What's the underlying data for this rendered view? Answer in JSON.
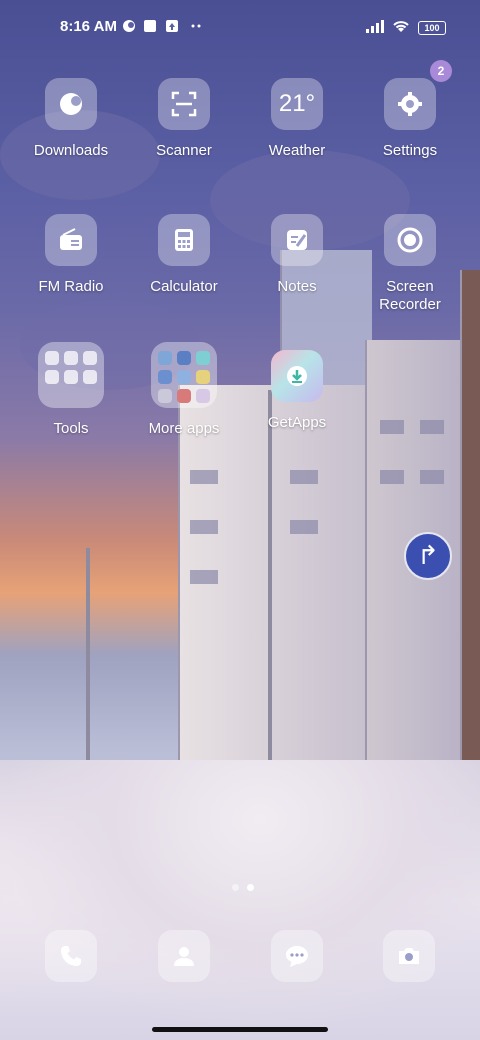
{
  "status_bar": {
    "time": "8:16 AM",
    "battery": "100"
  },
  "apps": [
    {
      "label": "Downloads",
      "icon": "downloads-icon"
    },
    {
      "label": "Scanner",
      "icon": "scanner-icon"
    },
    {
      "label": "Weather",
      "icon": "weather-icon",
      "tile_text": "21°"
    },
    {
      "label": "Settings",
      "icon": "gear-icon",
      "badge": "2"
    },
    {
      "label": "FM Radio",
      "icon": "radio-icon"
    },
    {
      "label": "Calculator",
      "icon": "calculator-icon"
    },
    {
      "label": "Notes",
      "icon": "notes-icon"
    },
    {
      "label": "Screen Recorder",
      "icon": "record-icon"
    },
    {
      "label": "Tools",
      "icon": "folder-icon"
    },
    {
      "label": "More apps",
      "icon": "folder-icon"
    },
    {
      "label": "GetApps",
      "icon": "getapps-icon"
    }
  ],
  "page_indicator": {
    "pages": 2,
    "active": 2
  },
  "dock": [
    {
      "icon": "phone-icon"
    },
    {
      "icon": "contacts-icon"
    },
    {
      "icon": "messages-icon"
    },
    {
      "icon": "camera-icon"
    }
  ]
}
